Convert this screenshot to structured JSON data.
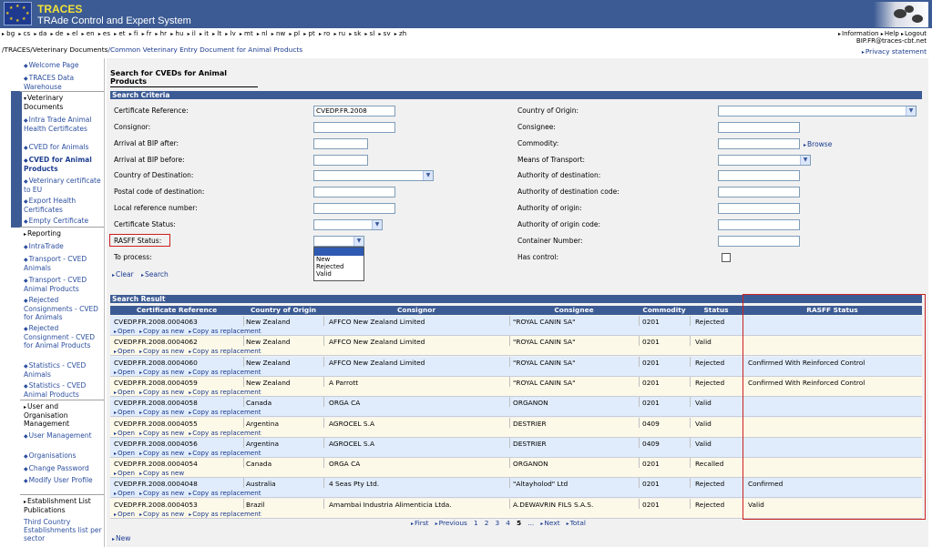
{
  "app": {
    "title": "TRACES",
    "subtitle": "TRAde Control and Expert System"
  },
  "languages": [
    "bg",
    "cs",
    "da",
    "de",
    "el",
    "en",
    "es",
    "et",
    "fi",
    "fr",
    "hr",
    "hu",
    "il",
    "it",
    "lt",
    "lv",
    "mt",
    "nl",
    "nw",
    "pl",
    "pt",
    "ro",
    "ru",
    "sk",
    "sl",
    "sv",
    "zh"
  ],
  "top": {
    "information": "Information",
    "help": "Help",
    "logout": "Logout",
    "user": "BIP.FR@traces-cbt.net",
    "privacy": "Privacy statement"
  },
  "breadcrumb": {
    "part1": "/TRACES/",
    "part2": "Veterinary Documents",
    "part3": "/Common Veterinary Entry Document for Animal Products"
  },
  "sidebar": {
    "welcome": "Welcome Page",
    "warehouse": "TRACES Data Warehouse",
    "vetdocs": "Veterinary Documents",
    "intra": "Intra Trade Animal Health Certificates",
    "cveda": "CVED for Animals",
    "cvedap": "CVED for Animal Products",
    "vetcert": "Veterinary certificate to EU",
    "export": "Export Health Certificates",
    "empty": "Empty Certificate",
    "reporting": "Reporting",
    "intratrade": "IntraTrade",
    "transa": "Transport - CVED Animals",
    "transap": "Transport - CVED Animal Products",
    "rejected": "Rejected Consignments - CVED for Animals",
    "rejectedap": "Rejected Consignment - CVED for Animal Products",
    "stata": "Statistics - CVED Animals",
    "statap": "Statistics - CVED Animal Products",
    "userorg": "User and Organisation Management",
    "usermgmt": "User Management",
    "orgs": "Organisations",
    "chpwd": "Change Password",
    "modprofile": "Modify User Profile",
    "estab": "Establishment List Publications",
    "thirdcountry": "Third Country Establishments list per sector"
  },
  "main": {
    "title": "Search for CVEDs for Animal Products",
    "criteria": "Search Criteria",
    "results": "Search Result"
  },
  "form": {
    "certref": {
      "label": "Certificate Reference:",
      "value": "CVEDP.FR.2008"
    },
    "consignor": "Consignor:",
    "arrafter": "Arrival at BIP after:",
    "arrbefore": "Arrival at BIP before:",
    "countrydest": "Country of Destination:",
    "postal": "Postal code of destination:",
    "localref": "Local reference number:",
    "certstatus": "Certificate Status:",
    "rasff": "RASFF Status:",
    "toprocess": "To process:",
    "countryorigin": "Country of Origin:",
    "consignee": "Consignee:",
    "commodity": "Commodity:",
    "browse": "Browse",
    "transport": "Means of Transport:",
    "authdest": "Authority of destination:",
    "authdestcode": "Authority of destination code:",
    "authorigin": "Authority of origin:",
    "authorigincode": "Authority of origin code:",
    "container": "Container Number:",
    "hascontrol": "Has control:",
    "clear": "Clear",
    "search": "Search",
    "rasff_options": [
      "New",
      "Rejected",
      "Valid"
    ]
  },
  "table": {
    "headers": [
      "Certificate Reference",
      "Country of Origin",
      "Consignor",
      "Consignee",
      "Commodity",
      "Status",
      "RASFF Status"
    ],
    "links": {
      "open": "Open",
      "copynew": "Copy as new",
      "copyrepl": "Copy as replacement"
    },
    "rows": [
      {
        "ref": "CVEDP.FR.2008.0004063",
        "country": "New Zealand",
        "consignor": "AFFCO New Zealand Limited",
        "consignee": "\"ROYAL CANIN SA\"",
        "commodity": "0201",
        "status": "Rejected",
        "rasff": ""
      },
      {
        "ref": "CVEDP.FR.2008.0004062",
        "country": "New Zealand",
        "consignor": "AFFCO New Zealand Limited",
        "consignee": "\"ROYAL CANIN SA\"",
        "commodity": "0201",
        "status": "Valid",
        "rasff": ""
      },
      {
        "ref": "CVEDP.FR.2008.0004060",
        "country": "New Zealand",
        "consignor": "AFFCO New Zealand Limited",
        "consignee": "\"ROYAL CANIN SA\"",
        "commodity": "0201",
        "status": "Rejected",
        "rasff": "Confirmed With Reinforced Control"
      },
      {
        "ref": "CVEDP.FR.2008.0004059",
        "country": "New Zealand",
        "consignor": "A Parrott",
        "consignee": "\"ROYAL CANIN SA\"",
        "commodity": "0201",
        "status": "Rejected",
        "rasff": "Confirmed With Reinforced Control"
      },
      {
        "ref": "CVEDP.FR.2008.0004058",
        "country": "Canada",
        "consignor": "ORGA CA",
        "consignee": "ORGANON",
        "commodity": "0201",
        "status": "Valid",
        "rasff": ""
      },
      {
        "ref": "CVEDP.FR.2008.0004055",
        "country": "Argentina",
        "consignor": "AGROCEL S.A",
        "consignee": "DESTRIER",
        "commodity": "0409",
        "status": "Valid",
        "rasff": ""
      },
      {
        "ref": "CVEDP.FR.2008.0004056",
        "country": "Argentina",
        "consignor": "AGROCEL S.A",
        "consignee": "DESTRIER",
        "commodity": "0409",
        "status": "Valid",
        "rasff": ""
      },
      {
        "ref": "CVEDP.FR.2008.0004054",
        "country": "Canada",
        "consignor": "ORGA CA",
        "consignee": "ORGANON",
        "commodity": "0201",
        "status": "Recalled",
        "rasff": ""
      },
      {
        "ref": "CVEDP.FR.2008.0004048",
        "country": "Australia",
        "consignor": "4 Seas Pty Ltd.",
        "consignee": "\"Altayholod\" Ltd",
        "commodity": "0201",
        "status": "Rejected",
        "rasff": "Confirmed"
      },
      {
        "ref": "CVEDP.FR.2008.0004053",
        "country": "Brazil",
        "consignor": "Amambai Industria Alimenticia Ltda.",
        "consignee": "A.DEWAVRIN FILS S.A.S.",
        "commodity": "0201",
        "status": "Rejected",
        "rasff": "Valid"
      }
    ]
  },
  "pager": {
    "first": "First",
    "previous": "Previous",
    "pages": [
      "1",
      "2",
      "3",
      "4",
      "5"
    ],
    "current": "5",
    "ellipsis": "...",
    "next": "Next",
    "total": "Total"
  },
  "newlink": "New"
}
